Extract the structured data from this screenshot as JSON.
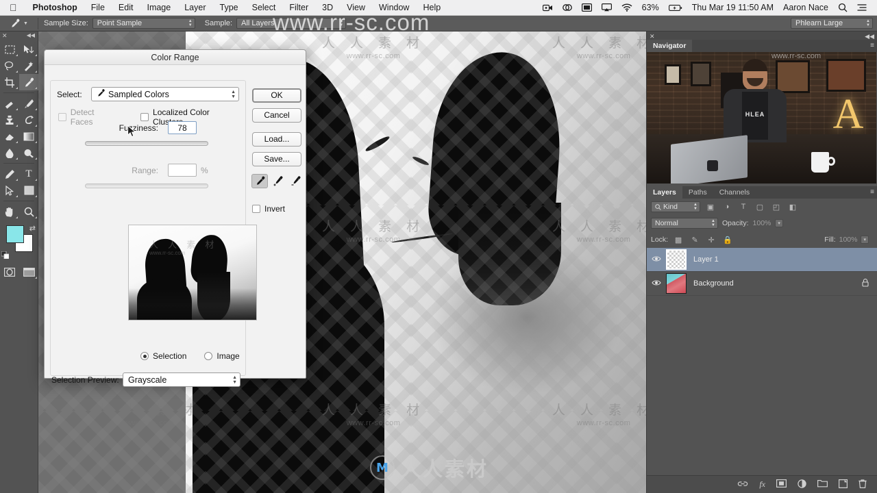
{
  "menubar": {
    "apple_icon": "apple-icon",
    "items": [
      {
        "label": "Photoshop",
        "bold": true
      },
      {
        "label": "File"
      },
      {
        "label": "Edit"
      },
      {
        "label": "Image"
      },
      {
        "label": "Layer"
      },
      {
        "label": "Type"
      },
      {
        "label": "Select"
      },
      {
        "label": "Filter"
      },
      {
        "label": "3D"
      },
      {
        "label": "View"
      },
      {
        "label": "Window"
      },
      {
        "label": "Help"
      }
    ],
    "status": {
      "battery_percent": "63%",
      "datetime": "Thu Mar 19  11:50 AM",
      "user": "Aaron Nace",
      "icons": [
        "screen-recording-icon",
        "dropbox-icon",
        "display-icon",
        "airplay-icon",
        "wifi-icon",
        "battery-icon",
        "search-icon",
        "notification-center-icon"
      ]
    }
  },
  "options_bar": {
    "tool_icon": "eyedropper-icon",
    "sample_size_label": "Sample Size:",
    "sample_size_value": "Point Sample",
    "sample_label": "Sample:",
    "sample_value": "All Layers",
    "workspace": "Phlearn Large"
  },
  "toolbar": {
    "tools": [
      {
        "name": "marquee-tool",
        "glyph": "▭"
      },
      {
        "name": "move-tool",
        "glyph": "➤"
      },
      {
        "name": "lasso-tool",
        "glyph": "◯"
      },
      {
        "name": "magic-wand-tool",
        "glyph": "✦"
      },
      {
        "name": "crop-tool",
        "glyph": "✛"
      },
      {
        "name": "eyedropper-tool",
        "glyph": "✐"
      },
      {
        "name": "healing-brush-tool",
        "glyph": "✎"
      },
      {
        "name": "brush-tool",
        "glyph": "🖌"
      },
      {
        "name": "clone-stamp-tool",
        "glyph": "⎍"
      },
      {
        "name": "history-brush-tool",
        "glyph": "↻"
      },
      {
        "name": "eraser-tool",
        "glyph": "▱"
      },
      {
        "name": "gradient-tool",
        "glyph": "▦"
      },
      {
        "name": "blur-tool",
        "glyph": "◗"
      },
      {
        "name": "dodge-tool",
        "glyph": "◔"
      },
      {
        "name": "pen-tool",
        "glyph": "✒"
      },
      {
        "name": "type-tool",
        "glyph": "T"
      },
      {
        "name": "path-selection-tool",
        "glyph": "↖"
      },
      {
        "name": "shape-tool",
        "glyph": "▣"
      },
      {
        "name": "hand-tool",
        "glyph": "✋"
      },
      {
        "name": "zoom-tool",
        "glyph": "🔍"
      }
    ],
    "foreground_color": "#89e6e9",
    "background_color": "#ffffff",
    "quickmask_name": "quick-mask-icon",
    "screenmode_name": "screen-mode-icon"
  },
  "dialog": {
    "title": "Color Range",
    "select_label": "Select:",
    "select_value": "Sampled Colors",
    "detect_faces_label": "Detect Faces",
    "detect_faces_checked": false,
    "localized_clusters_label": "Localized Color Clusters",
    "localized_clusters_checked": false,
    "fuzziness_label": "Fuzziness:",
    "fuzziness_value": "78",
    "range_label": "Range:",
    "range_value": "",
    "range_unit": "%",
    "buttons": {
      "ok": "OK",
      "cancel": "Cancel",
      "load": "Load...",
      "save": "Save..."
    },
    "eyedroppers": [
      {
        "name": "eyedropper-sample-icon",
        "selected": true
      },
      {
        "name": "eyedropper-add-icon",
        "selected": false
      },
      {
        "name": "eyedropper-subtract-icon",
        "selected": false
      }
    ],
    "invert_label": "Invert",
    "invert_checked": false,
    "preview_mode_selection": "Selection",
    "preview_mode_image": "Image",
    "preview_mode_value": "Selection",
    "selection_preview_label": "Selection Preview:",
    "selection_preview_value": "Grayscale"
  },
  "navigator": {
    "tab_label": "Navigator",
    "panel_menu_icon": "panel-menu-icon",
    "close_icon": "close-icon",
    "collapse_icon": "collapse-icon"
  },
  "layers_panel": {
    "tabs": [
      {
        "label": "Layers",
        "active": true
      },
      {
        "label": "Paths",
        "active": false
      },
      {
        "label": "Channels",
        "active": false
      }
    ],
    "filter_kind": "Kind",
    "filter_icons": [
      "pixel-filter-icon",
      "adjustment-filter-icon",
      "type-filter-icon",
      "shape-filter-icon",
      "smartobject-filter-icon",
      "filter-toggle-icon"
    ],
    "blend_mode": "Normal",
    "opacity_label": "Opacity:",
    "opacity_value": "100%",
    "lock_label": "Lock:",
    "lock_icons": [
      "lock-transparency-icon",
      "lock-image-icon",
      "lock-position-icon",
      "lock-all-icon"
    ],
    "fill_label": "Fill:",
    "fill_value": "100%",
    "layers": [
      {
        "name": "Layer 1",
        "selected": true,
        "locked": false,
        "thumb": "transparent",
        "visible": true
      },
      {
        "name": "Background",
        "selected": false,
        "locked": true,
        "thumb": "photo",
        "visible": true
      }
    ],
    "footer_icons": [
      "link-layers-icon",
      "layer-style-icon",
      "layer-mask-icon",
      "adjustment-layer-icon",
      "new-group-icon",
      "new-layer-icon",
      "delete-layer-icon"
    ]
  },
  "watermarks": {
    "top_banner": "www.rr-sc.com",
    "cn_text": "人 人 素 材",
    "cn_url": "www.rr-sc.com",
    "logo_text": "人人素材",
    "logo_mark": "M"
  }
}
